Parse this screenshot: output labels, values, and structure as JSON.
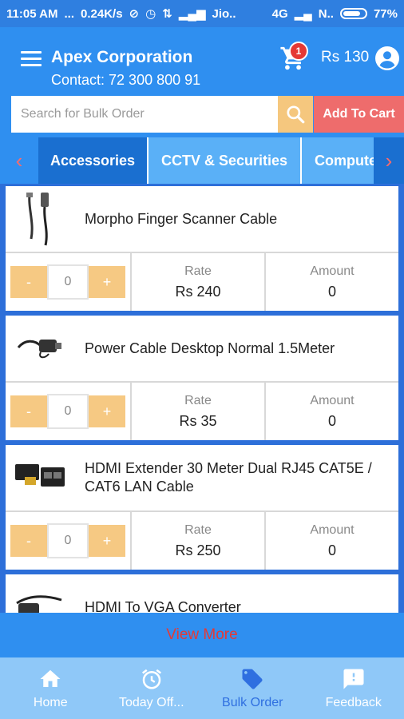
{
  "status_bar": {
    "time": "11:05 AM",
    "dots": "...",
    "speed": "0.24K/s",
    "carrier": "Jio..",
    "network": "4G",
    "carrier2": "N..",
    "battery": "77%"
  },
  "header": {
    "title": "Apex Corporation",
    "contact": "Contact: 72 300 800 91",
    "cart_count": "1",
    "cart_amount": "Rs 130"
  },
  "search": {
    "placeholder": "Search for Bulk Order",
    "add_to_cart_label": "Add To Cart"
  },
  "tabs": [
    {
      "label": "Accessories"
    },
    {
      "label": "CCTV & Securities"
    },
    {
      "label": "Computer"
    }
  ],
  "products": [
    {
      "name": "Morpho Finger Scanner Cable",
      "qty": "0",
      "rate_label": "Rate",
      "rate": "Rs 240",
      "amount_label": "Amount",
      "amount": "0"
    },
    {
      "name": "Power Cable Desktop Normal 1.5Meter",
      "qty": "0",
      "rate_label": "Rate",
      "rate": "Rs 35",
      "amount_label": "Amount",
      "amount": "0"
    },
    {
      "name": "HDMI Extender 30 Meter Dual RJ45 CAT5E / CAT6 LAN Cable",
      "qty": "0",
      "rate_label": "Rate",
      "rate": "Rs 250",
      "amount_label": "Amount",
      "amount": "0"
    },
    {
      "name": "HDMI To VGA Converter"
    }
  ],
  "qty_controls": {
    "minus": "-",
    "plus": "+"
  },
  "view_more": "View More",
  "bottom_nav": [
    {
      "label": "Home",
      "icon": "home-icon"
    },
    {
      "label": "Today Off...",
      "icon": "alarm-clock-icon"
    },
    {
      "label": "Bulk Order",
      "icon": "tag-icon"
    },
    {
      "label": "Feedback",
      "icon": "feedback-icon"
    }
  ],
  "colors": {
    "primary": "#2f8ff0",
    "accent_red": "#e53935",
    "qty_button": "#f6c983"
  }
}
